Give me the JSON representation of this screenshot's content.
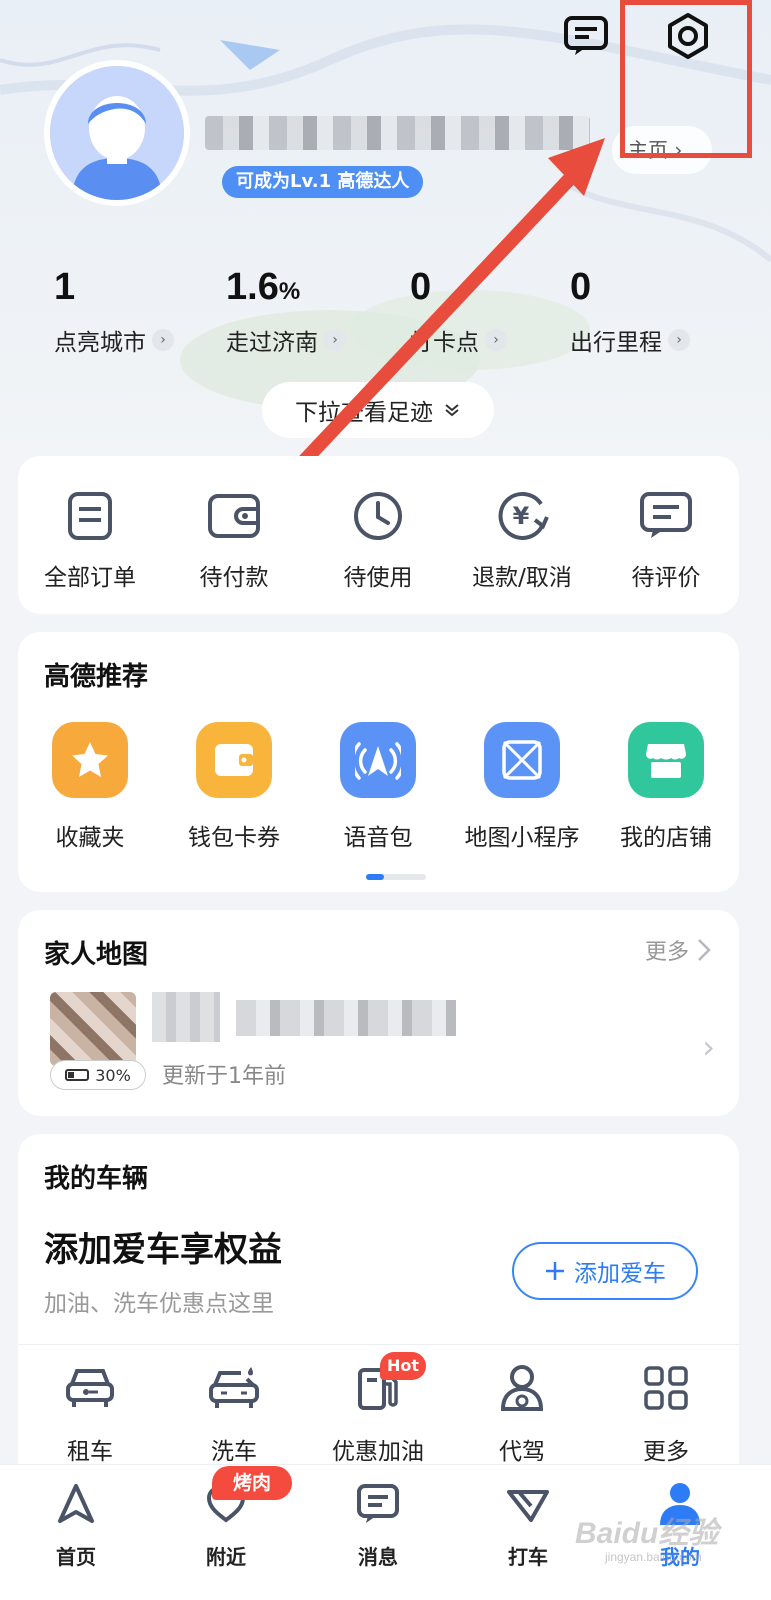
{
  "header": {
    "level_badge": "可成为Lv.1 高德达人",
    "home_link": "主页 ›",
    "pulldown_label": "下拉查看足迹"
  },
  "stats": [
    {
      "value": "1",
      "unit": "",
      "label": "点亮城市"
    },
    {
      "value": "1.6",
      "unit": "%",
      "label": "走过济南"
    },
    {
      "value": "0",
      "unit": "",
      "label": "打卡点"
    },
    {
      "value": "0",
      "unit": "",
      "label": "出行里程"
    }
  ],
  "orders": [
    {
      "label": "全部订单",
      "icon": "order-list-icon"
    },
    {
      "label": "待付款",
      "icon": "wallet-icon"
    },
    {
      "label": "待使用",
      "icon": "clock-icon"
    },
    {
      "label": "退款/取消",
      "icon": "refund-icon"
    },
    {
      "label": "待评价",
      "icon": "comment-icon"
    }
  ],
  "recommend": {
    "title": "高德推荐",
    "items": [
      {
        "label": "收藏夹",
        "icon": "star-icon",
        "color": "#f7a93b"
      },
      {
        "label": "钱包卡券",
        "icon": "wallet-icon",
        "color": "#f9b43c"
      },
      {
        "label": "语音包",
        "icon": "voice-nav-icon",
        "color": "#5a93f5"
      },
      {
        "label": "地图小程序",
        "icon": "map-miniapp-icon",
        "color": "#5b93f6"
      },
      {
        "label": "我的店铺",
        "icon": "store-icon",
        "color": "#2fc79b"
      }
    ]
  },
  "family": {
    "title": "家人地图",
    "more": "更多",
    "battery": "30%",
    "updated": "更新于1年前"
  },
  "vehicle": {
    "title": "我的车辆",
    "headline": "添加爱车享权益",
    "subtitle": "加油、洗车优惠点这里",
    "add_button": "添加爱车",
    "services": [
      {
        "label": "租车",
        "icon": "car-rental-icon"
      },
      {
        "label": "洗车",
        "icon": "car-wash-icon"
      },
      {
        "label": "优惠加油",
        "icon": "fuel-icon"
      },
      {
        "label": "代驾",
        "icon": "driver-icon"
      },
      {
        "label": "更多",
        "icon": "grid-icon"
      }
    ],
    "hot_badge": "Hot"
  },
  "nav": {
    "items": [
      {
        "label": "首页",
        "icon": "navigation-arrow-icon"
      },
      {
        "label": "附近",
        "icon": "nearby-icon"
      },
      {
        "label": "消息",
        "icon": "message-icon"
      },
      {
        "label": "打车",
        "icon": "taxi-icon"
      },
      {
        "label": "我的",
        "icon": "profile-icon"
      }
    ],
    "bbq_badge": "烤肉",
    "active_color": "#2d7cf6"
  },
  "watermark": {
    "text": "Baidu经验",
    "sub": "jingyan.baidu.com"
  },
  "colors": {
    "accent": "#2d7cf6",
    "annotation_red": "#e74c3c"
  }
}
